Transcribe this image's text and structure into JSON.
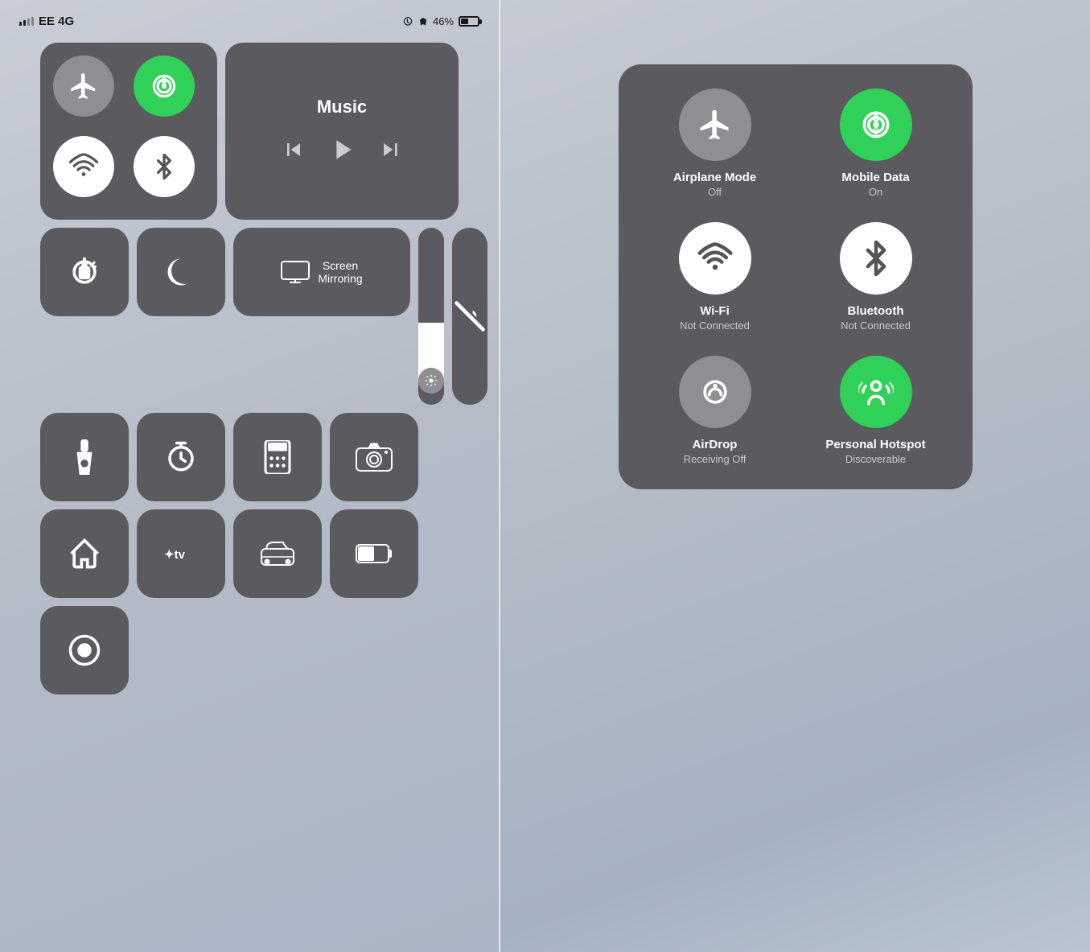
{
  "status_bar": {
    "carrier": "EE 4G",
    "time": "",
    "battery_percent": "46%",
    "alarm_icon": "alarm-icon",
    "location_icon": "location-icon"
  },
  "connectivity_buttons": [
    {
      "id": "airplane",
      "label": "Airplane Mode",
      "state": "off",
      "color": "gray"
    },
    {
      "id": "mobile_data",
      "label": "Mobile Data",
      "state": "on",
      "color": "green"
    },
    {
      "id": "wifi",
      "label": "Wi-Fi",
      "state": "not_connected",
      "color": "white"
    },
    {
      "id": "bluetooth",
      "label": "Bluetooth",
      "state": "not_connected",
      "color": "white"
    }
  ],
  "music": {
    "title": "Music",
    "prev_label": "previous",
    "play_label": "play",
    "next_label": "next"
  },
  "controls": {
    "screen_rotation_lock": "Screen Rotation Lock",
    "do_not_disturb": "Do Not Disturb",
    "screen_mirroring": "Screen\nMirroring",
    "brightness": "Brightness",
    "silent": "Silent"
  },
  "bottom_icons": [
    {
      "id": "flashlight",
      "label": "Flashlight"
    },
    {
      "id": "timer",
      "label": "Timer"
    },
    {
      "id": "calculator",
      "label": "Calculator"
    },
    {
      "id": "camera",
      "label": "Camera"
    },
    {
      "id": "home",
      "label": "Home"
    },
    {
      "id": "apple_tv",
      "label": "Apple TV"
    },
    {
      "id": "carplay",
      "label": "CarPlay"
    },
    {
      "id": "battery",
      "label": "Battery"
    },
    {
      "id": "screen_record",
      "label": "Screen Record"
    }
  ],
  "popup": {
    "items": [
      {
        "id": "airplane_mode",
        "title": "Airplane Mode",
        "subtitle": "Off",
        "state": "off",
        "color": "gray"
      },
      {
        "id": "mobile_data",
        "title": "Mobile Data",
        "subtitle": "On",
        "state": "on",
        "color": "green"
      },
      {
        "id": "wifi",
        "title": "Wi-Fi",
        "subtitle": "Not Connected",
        "state": "not_connected",
        "color": "white"
      },
      {
        "id": "bluetooth",
        "title": "Bluetooth",
        "subtitle": "Not Connected",
        "state": "not_connected",
        "color": "white"
      },
      {
        "id": "airdrop",
        "title": "AirDrop",
        "subtitle": "Receiving Off",
        "state": "off",
        "color": "gray"
      },
      {
        "id": "personal_hotspot",
        "title": "Personal Hotspot",
        "subtitle": "Discoverable",
        "state": "on",
        "color": "green"
      }
    ]
  }
}
